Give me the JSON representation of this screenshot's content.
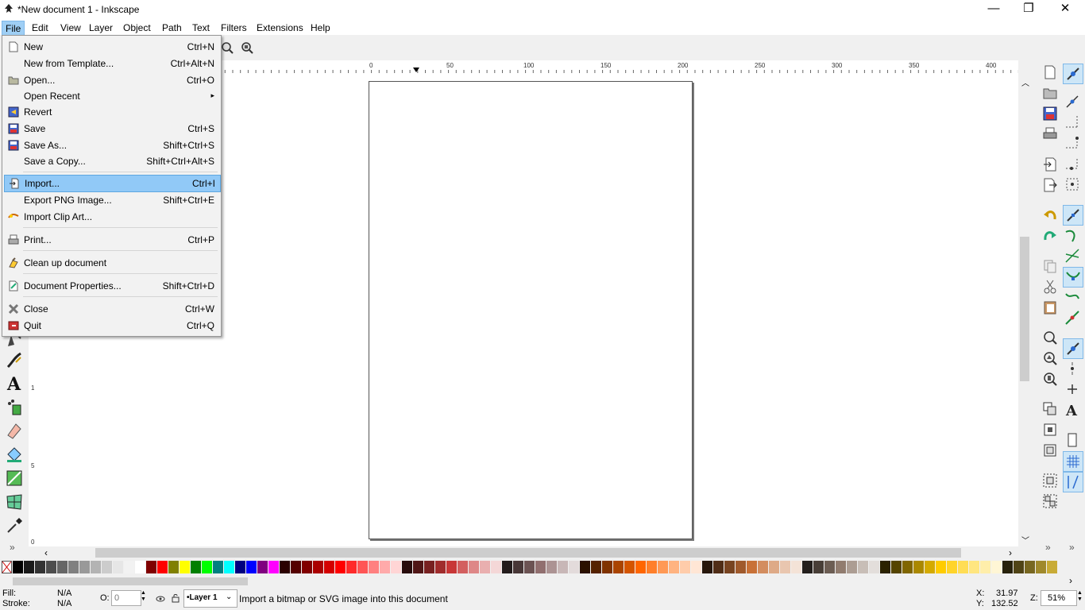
{
  "window": {
    "title": "*New document 1 - Inkscape",
    "minimize": "—",
    "maximize": "❐",
    "close": "✕"
  },
  "menubar": [
    "File",
    "Edit",
    "View",
    "Layer",
    "Object",
    "Path",
    "Text",
    "Filters",
    "Extensions",
    "Help"
  ],
  "file_menu": [
    {
      "label": "New",
      "shortcut": "Ctrl+N",
      "icon": "new-document-icon"
    },
    {
      "label": "New from Template...",
      "shortcut": "Ctrl+Alt+N",
      "icon": ""
    },
    {
      "label": "Open...",
      "shortcut": "Ctrl+O",
      "icon": "open-folder-icon"
    },
    {
      "label": "Open Recent",
      "shortcut": "▸",
      "icon": ""
    },
    {
      "label": "Revert",
      "shortcut": "",
      "icon": "revert-icon"
    },
    {
      "label": "Save",
      "shortcut": "Ctrl+S",
      "icon": "save-icon"
    },
    {
      "label": "Save As...",
      "shortcut": "Shift+Ctrl+S",
      "icon": "save-as-icon"
    },
    {
      "label": "Save a Copy...",
      "shortcut": "Shift+Ctrl+Alt+S",
      "icon": ""
    },
    {
      "label": "Import...",
      "shortcut": "Ctrl+I",
      "icon": "import-icon"
    },
    {
      "label": "Export PNG Image...",
      "shortcut": "Shift+Ctrl+E",
      "icon": ""
    },
    {
      "label": "Import Clip Art...",
      "shortcut": "",
      "icon": "clip-art-icon"
    },
    {
      "label": "Print...",
      "shortcut": "Ctrl+P",
      "icon": "print-icon"
    },
    {
      "label": "Clean up document",
      "shortcut": "",
      "icon": "clean-up-icon"
    },
    {
      "label": "Document Properties...",
      "shortcut": "Shift+Ctrl+D",
      "icon": "document-properties-icon"
    },
    {
      "label": "Close",
      "shortcut": "Ctrl+W",
      "icon": "close-document-icon"
    },
    {
      "label": "Quit",
      "shortcut": "Ctrl+Q",
      "icon": "quit-icon"
    }
  ],
  "ruler": {
    "h_ticks": [
      "0",
      "50",
      "100",
      "150",
      "200",
      "250",
      "300",
      "350",
      "400"
    ],
    "v_ticks": [
      "1",
      "5",
      "0"
    ]
  },
  "statusbar": {
    "fill_label": "Fill:",
    "fill_value": "N/A",
    "stroke_label": "Stroke:",
    "stroke_value": "N/A",
    "opacity_label": "O:",
    "opacity_value": "0",
    "layer": "•Layer 1",
    "message": "Import a bitmap or SVG image into this document",
    "x_label": "X:",
    "x_value": "31.97",
    "y_label": "Y:",
    "y_value": "132.52",
    "zoom_label": "Z:",
    "zoom_value": "51%"
  },
  "palette_colors": [
    "#000000",
    "#1a1a1a",
    "#333333",
    "#4d4d4d",
    "#666666",
    "#808080",
    "#999999",
    "#b3b3b3",
    "#cccccc",
    "#e6e6e6",
    "#f2f2f2",
    "#ffffff",
    "#800000",
    "#ff0000",
    "#808000",
    "#ffff00",
    "#008000",
    "#00ff00",
    "#008080",
    "#00ffff",
    "#000080",
    "#0000ff",
    "#800080",
    "#ff00ff",
    "#2b0000",
    "#550000",
    "#800000",
    "#aa0000",
    "#d40000",
    "#ff0000",
    "#ff2a2a",
    "#ff5555",
    "#ff8080",
    "#ffaaaa",
    "#ffd5d5",
    "#280b0b",
    "#501616",
    "#782121",
    "#a02c2c",
    "#c83737",
    "#d35f5f",
    "#de8787",
    "#e9afaf",
    "#f4d7d7",
    "#241c1c",
    "#483737",
    "#6c5353",
    "#916f6f",
    "#ac9393",
    "#c8b7b7",
    "#e3dbdb",
    "#2b1100",
    "#552200",
    "#803300",
    "#aa4400",
    "#d45500",
    "#ff6600",
    "#ff7f2a",
    "#ff9955",
    "#ffb380",
    "#ffccaa",
    "#ffe6d5",
    "#28170b",
    "#502d16",
    "#784421",
    "#a05a2c",
    "#c87137",
    "#d38d5f",
    "#deaa87",
    "#e9c6af",
    "#f4e3d7",
    "#241f1c",
    "#483e37",
    "#6c5d53",
    "#917c6f",
    "#ac9d93",
    "#c8beb7",
    "#e3dedb",
    "#2b2200",
    "#554400",
    "#806600",
    "#aa8800",
    "#d4aa00",
    "#ffcc00",
    "#ffd42a",
    "#ffdd55",
    "#ffe680",
    "#ffeeaa",
    "#fff6d5",
    "#28220b",
    "#504416",
    "#786721",
    "#a0892c",
    "#c8ab37"
  ]
}
